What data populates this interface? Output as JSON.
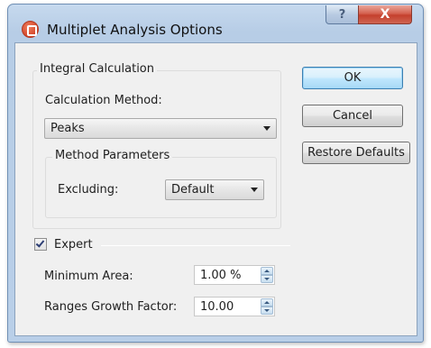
{
  "window": {
    "title": "Multiplet Analysis Options",
    "help_symbol": "?",
    "close_symbol": "X"
  },
  "integral": {
    "group_title": "Integral Calculation",
    "method_label": "Calculation Method:",
    "method_value": "Peaks",
    "params_title": "Method Parameters",
    "excluding_label": "Excluding:",
    "excluding_value": "Default"
  },
  "expert": {
    "label": "Expert",
    "checked": true,
    "min_area_label": "Minimum Area:",
    "min_area_value": "1.00 %",
    "growth_label": "Ranges Growth Factor:",
    "growth_value": "10.00"
  },
  "buttons": {
    "ok": "OK",
    "cancel": "Cancel",
    "restore": "Restore Defaults"
  }
}
